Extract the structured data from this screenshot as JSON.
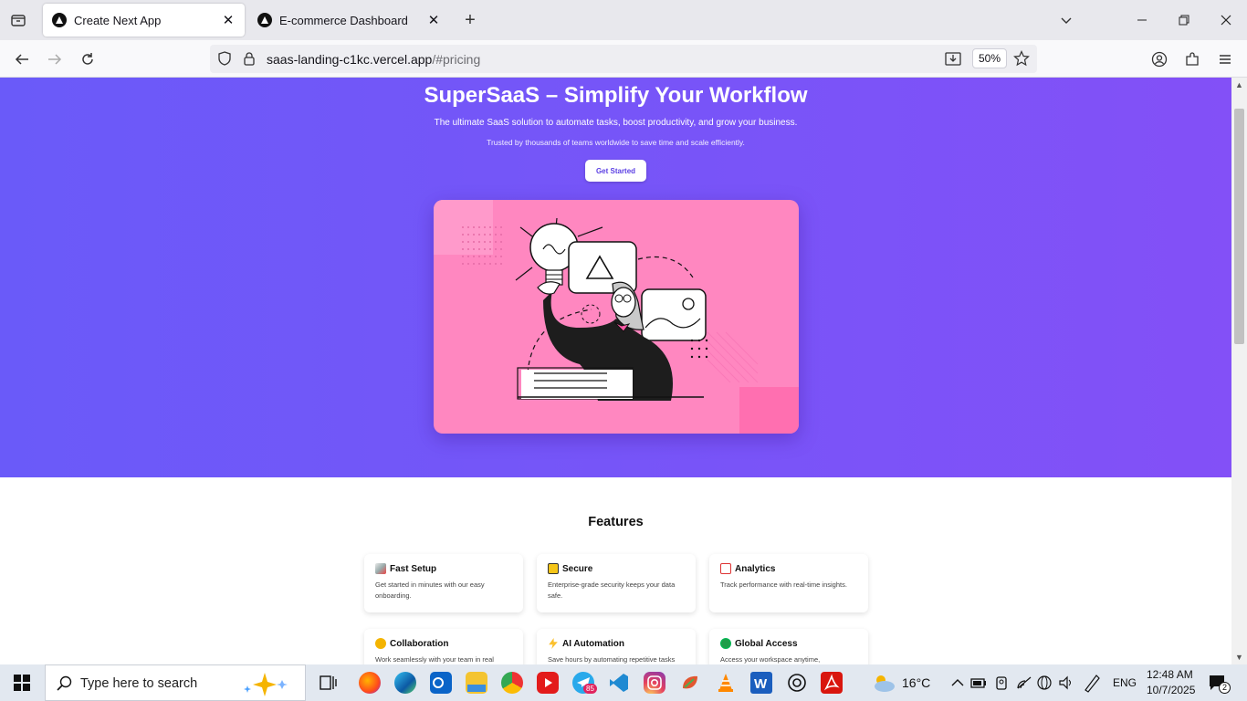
{
  "browser": {
    "tabs": [
      {
        "title": "Create Next App",
        "active": true
      },
      {
        "title": "E-commerce Dashboard",
        "active": false
      }
    ],
    "url_host": "saas-landing-c1kc.vercel.app",
    "url_path": "/#pricing",
    "zoom": "50%"
  },
  "hero": {
    "title": "SuperSaaS – Simplify Your Workflow",
    "subtitle": "The ultimate SaaS solution to automate tasks, boost productivity, and grow your business.",
    "trust": "Trusted by thousands of teams worldwide to save time and scale efficiently.",
    "cta": "Get Started"
  },
  "features": {
    "title": "Features",
    "items": [
      {
        "title": "Fast Setup",
        "desc": "Get started in minutes with our easy onboarding.",
        "icon": "rocket-icon"
      },
      {
        "title": "Secure",
        "desc": "Enterprise-grade security keeps your data safe.",
        "icon": "lock-icon"
      },
      {
        "title": "Analytics",
        "desc": "Track performance with real-time insights.",
        "icon": "chart-icon"
      },
      {
        "title": "Collaboration",
        "desc": "Work seamlessly with your team in real",
        "icon": "handshake-icon"
      },
      {
        "title": "AI Automation",
        "desc": "Save hours by automating repetitive tasks",
        "icon": "lightning-icon"
      },
      {
        "title": "Global Access",
        "desc": "Access your workspace anytime,",
        "icon": "globe-icon"
      }
    ]
  },
  "taskbar": {
    "search_placeholder": "Type here to search",
    "telegram_badge": "85",
    "weather": "16°C",
    "language": "ENG",
    "time": "12:48 AM",
    "date": "10/7/2025",
    "notifications": "2"
  },
  "colors": {
    "hero_left": "#6a5af9",
    "hero_right": "#8350f7",
    "illustration_bg": "#ff87c0",
    "cta_text": "#5b3fe3"
  }
}
